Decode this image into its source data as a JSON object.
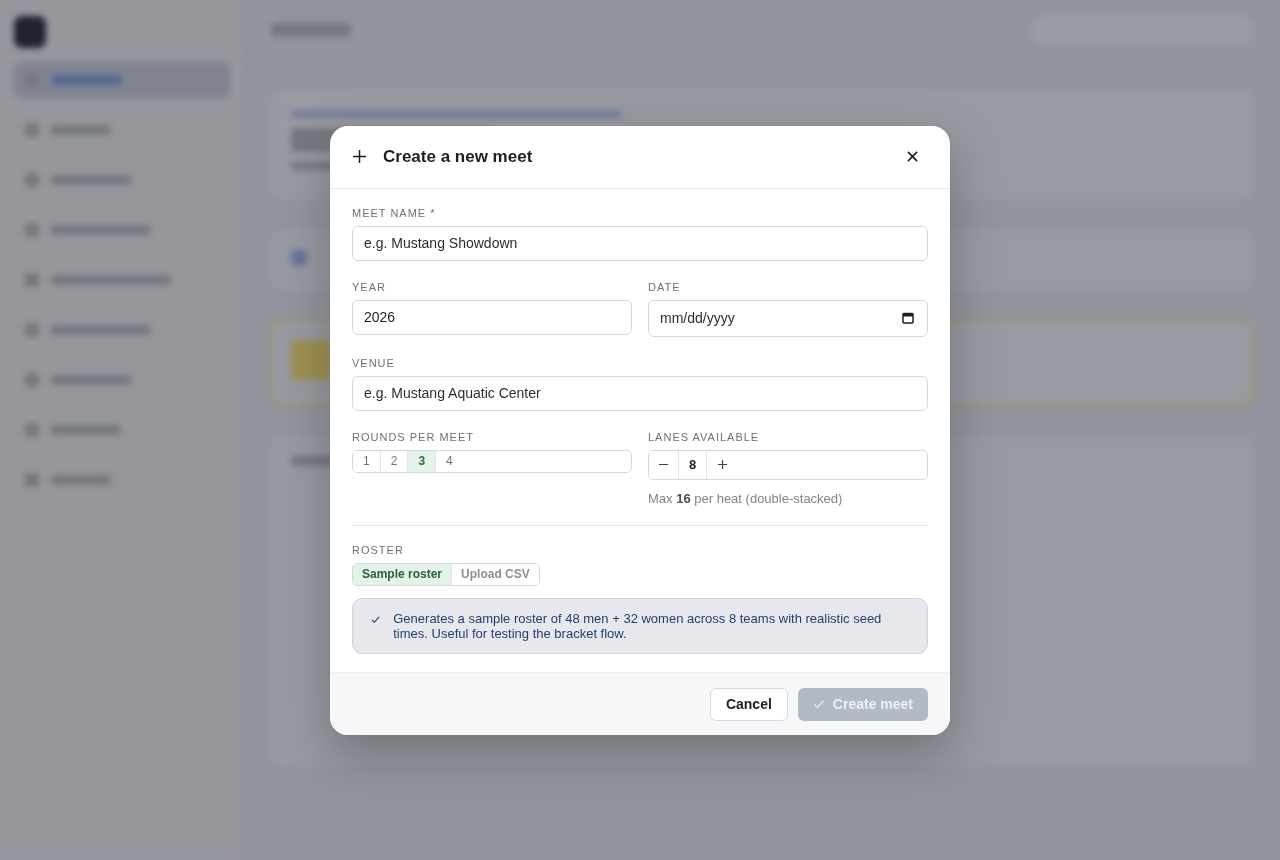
{
  "sidebar": {
    "items": [
      {
        "selected": true
      },
      {
        "selected": false
      },
      {
        "selected": false
      },
      {
        "selected": false
      },
      {
        "selected": false
      },
      {
        "selected": false
      },
      {
        "selected": false
      },
      {
        "selected": false
      },
      {
        "selected": false
      }
    ]
  },
  "dialog": {
    "title": "Create a new meet",
    "meet_name": {
      "label": "MEET NAME *",
      "placeholder": "e.g. Mustang Showdown"
    },
    "year": {
      "label": "YEAR",
      "value": "2026"
    },
    "date": {
      "label": "DATE",
      "placeholder": "mm/dd/yyyy"
    },
    "venue": {
      "label": "VENUE",
      "placeholder": "e.g. Mustang Aquatic Center"
    },
    "rounds": {
      "label": "ROUNDS PER MEET",
      "options": [
        {
          "label": "1",
          "selected": false
        },
        {
          "label": "2",
          "selected": false
        },
        {
          "label": "3",
          "selected": true
        },
        {
          "label": "4",
          "selected": false
        }
      ]
    },
    "lanes": {
      "label": "LANES AVAILABLE",
      "value": "8",
      "hint": "Max **16** per heat (double-stacked)"
    },
    "roster": {
      "label": "ROSTER",
      "tabs": [
        {
          "label": "Sample roster",
          "selected": true
        },
        {
          "label": "Upload CSV",
          "selected": false
        }
      ],
      "note": "Generates a sample roster of 48 men + 32 women across 8 teams with realistic seed times. Useful for testing the bracket flow."
    },
    "cancel": {
      "label": "Cancel"
    },
    "create": {
      "label": "Create meet",
      "disabled": true
    }
  }
}
